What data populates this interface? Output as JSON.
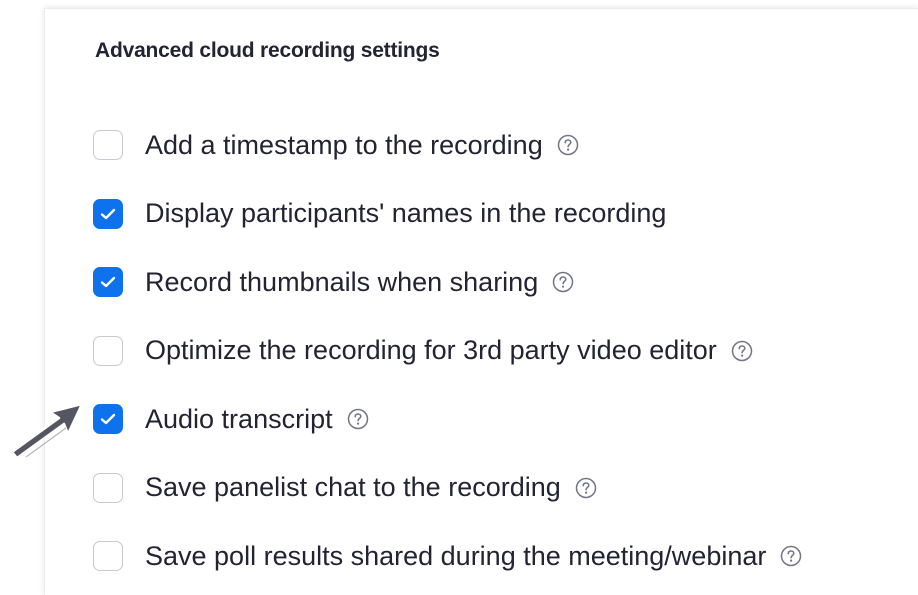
{
  "panel": {
    "title": "Advanced cloud recording settings"
  },
  "options": [
    {
      "label": "Add a timestamp to the recording",
      "checked": false,
      "has_help": true
    },
    {
      "label": "Display participants' names in the recording",
      "checked": true,
      "has_help": false
    },
    {
      "label": "Record thumbnails when sharing",
      "checked": true,
      "has_help": true
    },
    {
      "label": "Optimize the recording for 3rd party video editor",
      "checked": false,
      "has_help": true
    },
    {
      "label": "Audio transcript",
      "checked": true,
      "has_help": true
    },
    {
      "label": "Save panelist chat to the recording",
      "checked": false,
      "has_help": true
    },
    {
      "label": "Save poll results shared during the meeting/webinar",
      "checked": false,
      "has_help": true
    }
  ],
  "icons": {
    "checkbox_checked": "checkmark-icon",
    "help": "question-circle-icon",
    "pointer": "arrow-cursor-icon"
  },
  "colors": {
    "accent": "#0e72ed",
    "text": "#232333",
    "checkbox_border": "#c9c9d1",
    "help_icon": "#747487"
  }
}
